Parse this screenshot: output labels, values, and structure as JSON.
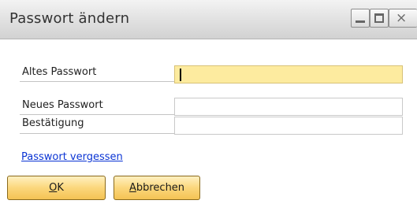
{
  "window": {
    "title": "Passwort ändern",
    "controls": {
      "minimize": "minimize-icon",
      "maximize": "maximize-icon",
      "close": "close-icon",
      "close_glyph": "×"
    }
  },
  "form": {
    "old_password": {
      "label": "Altes Passwort",
      "value": ""
    },
    "new_password": {
      "label": "Neues Passwort",
      "value": ""
    },
    "confirm_password": {
      "label": "Bestätigung",
      "value": ""
    }
  },
  "links": {
    "forgot_password": "Passwort vergessen"
  },
  "buttons": {
    "ok": {
      "mnemonic": "O",
      "rest": "K"
    },
    "cancel": {
      "mnemonic": "A",
      "rest": "bbrechen"
    }
  },
  "colors": {
    "active_field": "#fdeb9f",
    "button_fill": "#fbd77c",
    "link": "#0a34d4"
  }
}
